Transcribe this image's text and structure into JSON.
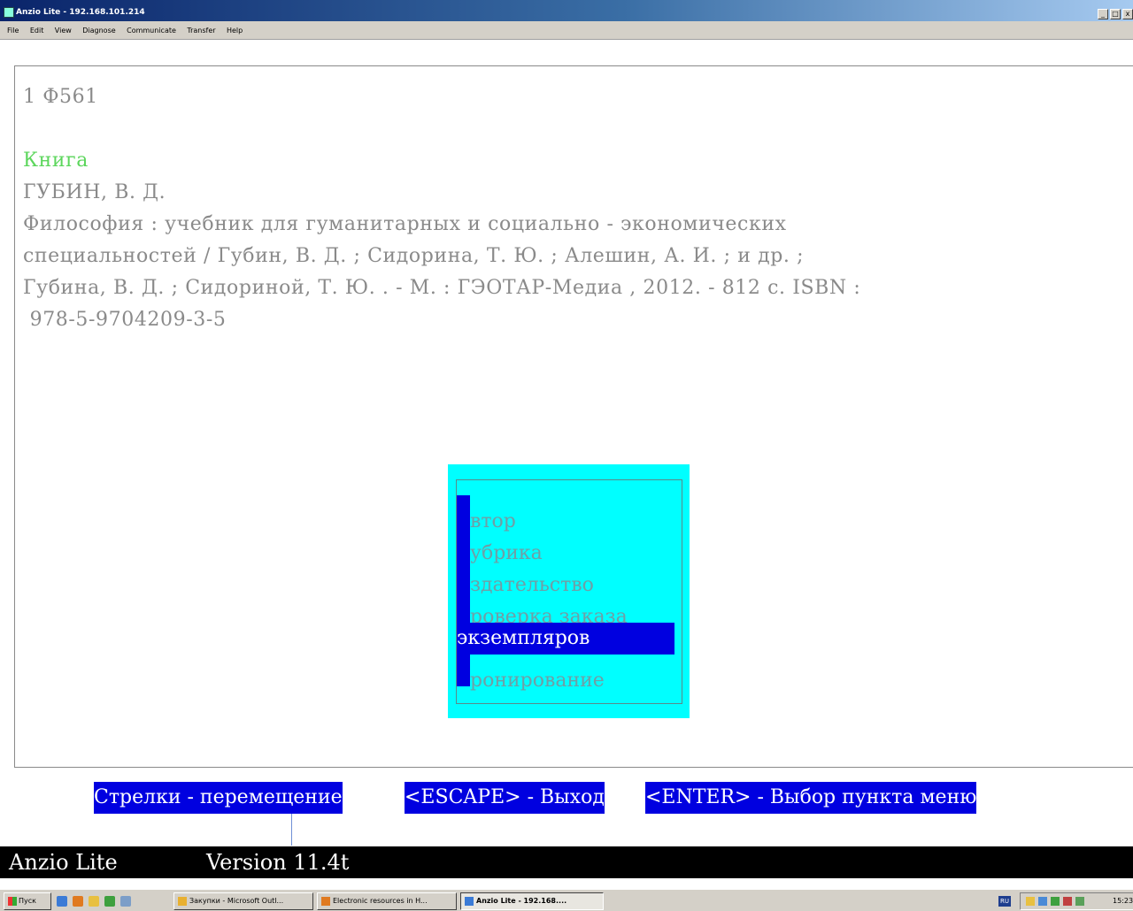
{
  "window": {
    "title": "Anzio Lite - 192.168.101.214",
    "menu": [
      "File",
      "Edit",
      "View",
      "Diagnose",
      "Communicate",
      "Transfer",
      "Help"
    ]
  },
  "terminal": {
    "record_number": "1 Ф561",
    "doc_type": "Книга",
    "author": "ГУБИН, В. Д.",
    "desc_line1": "Философия : учебник для гуманитарных и социально - экономических",
    "desc_line2": "специальностей / Губин, В. Д. ; Сидорина, Т. Ю. ; Алешин, А. И. ; и др. ;",
    "desc_line3": "Губина, В. Д. ; Сидориной, Т. Ю. . - М. : ГЭОТАР-Медиа , 2012. - 812 с. ISBN :",
    "isbn": " 978-5-9704209-3-5"
  },
  "popup_menu": {
    "items": [
      {
        "hot": "А",
        "rest": "втор"
      },
      {
        "hot": "Р",
        "rest": "убрика"
      },
      {
        "hot": "И",
        "rest": "здательство"
      },
      {
        "hot": "П",
        "rest": "роверка заказа"
      },
      {
        "hot": "",
        "rest": "экземпляров",
        "selected": true
      },
      {
        "hot": "Б",
        "rest": "ронирование"
      }
    ],
    "colors": {
      "background": "#00ffff",
      "highlight": "#0000e0",
      "text": "#6f9fa6"
    }
  },
  "hints": {
    "arrows": "Стрелки - перемещение",
    "escape": "<ESCAPE> - Выход",
    "enter": "<ENTER> - Выбор пункта меню"
  },
  "status": {
    "app": "Anzio Lite",
    "version": "Version 11.4t"
  },
  "taskbar": {
    "start": "Пуск",
    "tasks": [
      {
        "label": "Закупки - Microsoft Outl...",
        "active": false
      },
      {
        "label": "Electronic resources in H...",
        "active": false
      },
      {
        "label": "Anzio Lite - 192.168....",
        "active": true
      }
    ],
    "lang": "RU",
    "clock": "15:23"
  }
}
